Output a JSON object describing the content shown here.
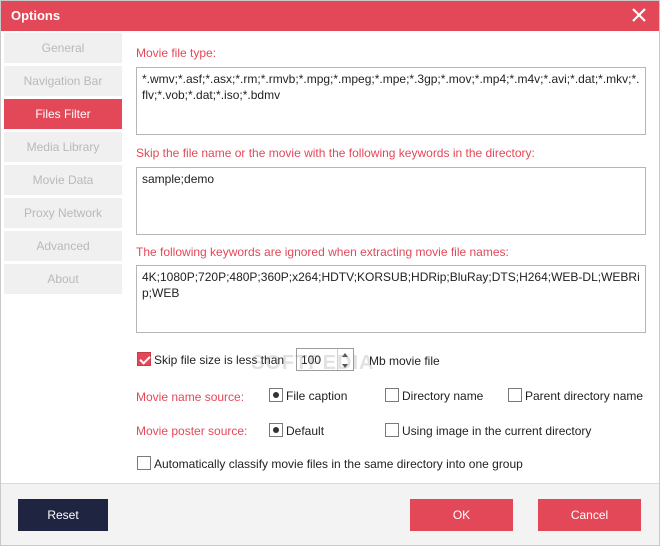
{
  "window": {
    "title": "Options"
  },
  "sidebar": {
    "items": [
      {
        "label": "General"
      },
      {
        "label": "Navigation Bar"
      },
      {
        "label": "Files Filter"
      },
      {
        "label": "Media Library"
      },
      {
        "label": "Movie Data"
      },
      {
        "label": "Proxy Network"
      },
      {
        "label": "Advanced"
      },
      {
        "label": "About"
      }
    ],
    "active_index": 2
  },
  "main": {
    "movie_file_type": {
      "label": "Movie file type:",
      "value": "*.wmv;*.asf;*.asx;*.rm;*.rmvb;*.mpg;*.mpeg;*.mpe;*.3gp;*.mov;*.mp4;*.m4v;*.avi;*.dat;*.mkv;*.flv;*.vob;*.dat;*.iso;*.bdmv"
    },
    "skip_keywords": {
      "label": "Skip the file name or the movie with the following keywords in the directory:",
      "value": "sample;demo"
    },
    "ignored_keywords": {
      "label": "The following keywords are ignored when extracting movie file names:",
      "value": "4K;1080P;720P;480P;360P;x264;HDTV;KORSUB;HDRip;BluRay;DTS;H264;WEB-DL;WEBRip;WEB"
    },
    "skip_size": {
      "checked": true,
      "label": "Skip file size is less than",
      "value": "100",
      "unit": "Mb movie file"
    },
    "name_source": {
      "label": "Movie name source:",
      "options": [
        {
          "label": "File caption",
          "selected": true
        },
        {
          "label": "Directory name",
          "selected": false
        },
        {
          "label": "Parent directory name",
          "selected": false
        }
      ]
    },
    "poster_source": {
      "label": "Movie poster source:",
      "options": [
        {
          "label": "Default",
          "selected": true
        },
        {
          "label": "Using image in the current directory",
          "selected": false
        }
      ]
    },
    "auto_classify": {
      "checked": false,
      "label": "Automatically classify movie files in the same directory into one group"
    }
  },
  "footer": {
    "reset_label": "Reset",
    "ok_label": "OK",
    "cancel_label": "Cancel"
  },
  "watermark": "SOFTPEDIA",
  "colors": {
    "accent": "#e34858",
    "dark_button": "#1f2541",
    "sidebar_bg": "#f0f0f0",
    "sidebar_text": "#b9b9b9"
  },
  "icons": {
    "close": "close-icon",
    "spin_up": "chevron-up-icon",
    "spin_down": "chevron-down-icon"
  }
}
